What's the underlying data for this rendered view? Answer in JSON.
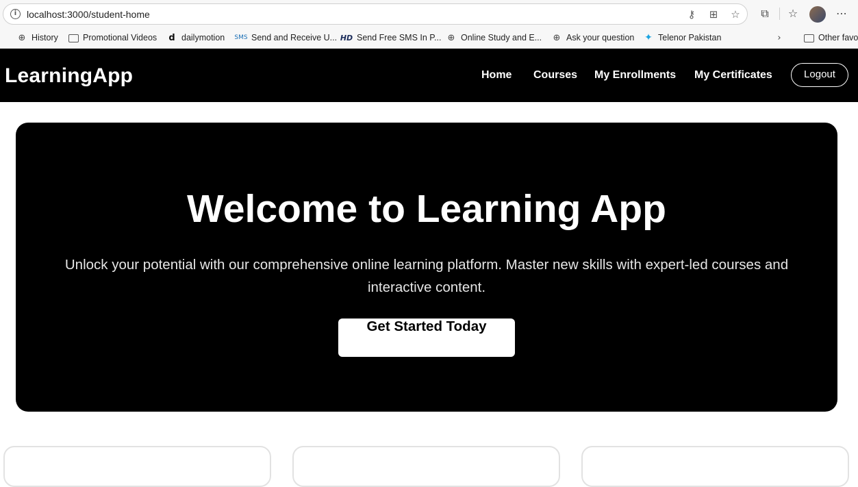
{
  "browser": {
    "url": "localhost:3000/student-home",
    "bookmarks": [
      {
        "label": "History",
        "icon": "globe-icon"
      },
      {
        "label": "Promotional Videos",
        "icon": "folder-icon"
      },
      {
        "label": "dailymotion",
        "icon": "dailymotion-icon"
      },
      {
        "label": "Send and Receive U...",
        "icon": "sms-icon"
      },
      {
        "label": "Send Free SMS In P...",
        "icon": "hd-icon"
      },
      {
        "label": "Online Study and E...",
        "icon": "globe-icon"
      },
      {
        "label": "Ask your question",
        "icon": "globe-icon"
      },
      {
        "label": "Telenor Pakistan",
        "icon": "telenor-icon"
      },
      {
        "label": "Other favo",
        "icon": "folder-icon"
      }
    ]
  },
  "nav": {
    "brand": "LearningApp",
    "links": [
      "Home",
      "Courses",
      "My Enrollments",
      "My Certificates"
    ],
    "logout": "Logout"
  },
  "hero": {
    "title": "Welcome to Learning App",
    "subtitle": "Unlock your potential with our comprehensive online learning platform. Master new skills with expert-led courses and interactive content.",
    "cta": "Get Started Today"
  },
  "colors": {
    "nav_bg": "#000000",
    "hero_bg": "#000000",
    "text_on_dark": "#ffffff"
  }
}
